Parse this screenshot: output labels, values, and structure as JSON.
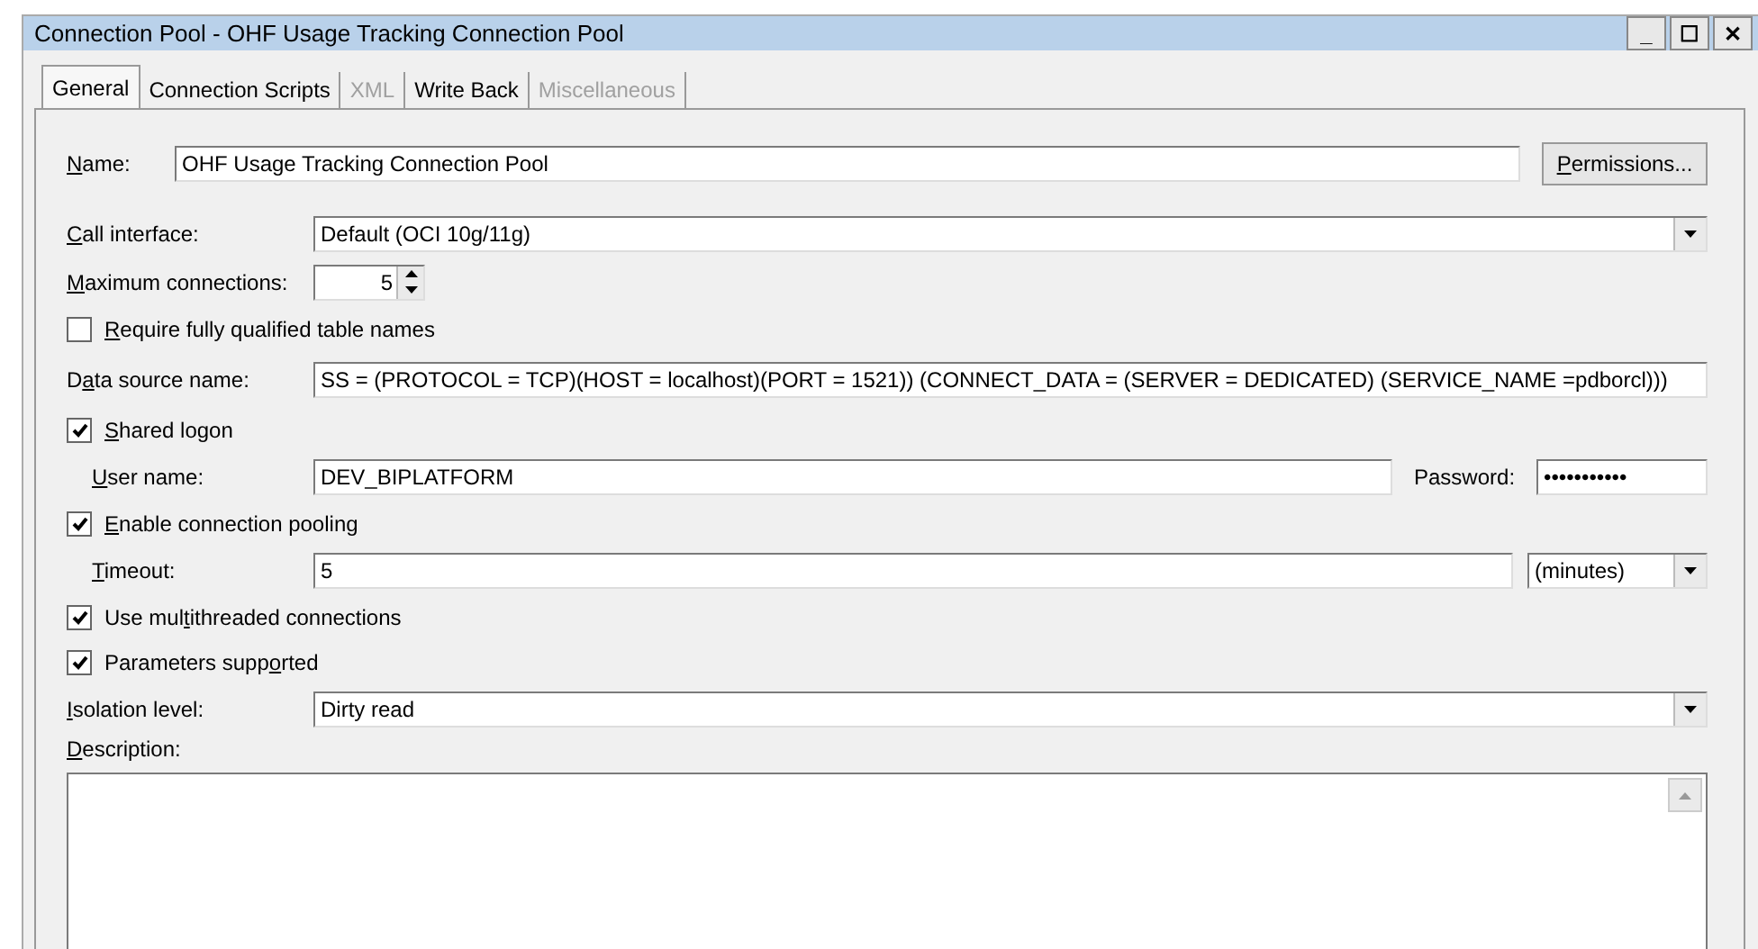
{
  "window": {
    "title": "Connection Pool - OHF Usage Tracking Connection Pool",
    "controls": [
      "_",
      "☐",
      "✕"
    ]
  },
  "tabs": [
    {
      "label": "General",
      "selected": true,
      "disabled": false
    },
    {
      "label": "Connection Scripts",
      "selected": false,
      "disabled": false
    },
    {
      "label": "XML",
      "selected": false,
      "disabled": true
    },
    {
      "label": "Write Back",
      "selected": false,
      "disabled": false
    },
    {
      "label": "Miscellaneous",
      "selected": false,
      "disabled": true
    }
  ],
  "form": {
    "name": {
      "label": {
        "key": "N",
        "post": "ame:"
      },
      "value": "OHF Usage Tracking Connection Pool",
      "button": {
        "key": "P",
        "post": "ermissions..."
      }
    },
    "call_interface": {
      "label": {
        "key": "C",
        "post": "all interface:"
      },
      "value": "Default (OCI 10g/11g)"
    },
    "max_connections": {
      "label": {
        "key": "M",
        "post": "aximum connections:"
      },
      "value": "5"
    },
    "require_qualified": {
      "label": {
        "key": "R",
        "post": "equire fully qualified table names"
      },
      "checked": false
    },
    "data_source": {
      "label": {
        "pre": "D",
        "key": "a",
        "post": "ta source name:"
      },
      "value": "SS = (PROTOCOL = TCP)(HOST = localhost)(PORT = 1521)) (CONNECT_DATA = (SERVER = DEDICATED) (SERVICE_NAME =pdborcl)))"
    },
    "shared_logon": {
      "label": {
        "key": "S",
        "post": "hared logon"
      },
      "checked": true
    },
    "user_name": {
      "label": {
        "key": "U",
        "post": "ser name:"
      },
      "value": "DEV_BIPLATFORM"
    },
    "password": {
      "label": {
        "pre": "Password:"
      },
      "value": "•••••••••••"
    },
    "enable_pooling": {
      "label": {
        "key": "E",
        "post": "nable connection pooling"
      },
      "checked": true
    },
    "timeout": {
      "label": {
        "key": "T",
        "post": "imeout:"
      },
      "value": "5",
      "unit": "(minutes)"
    },
    "multithreaded": {
      "label": {
        "pre": "Use mul",
        "key": "t",
        "post": "ithreaded connections"
      },
      "checked": true
    },
    "parameters": {
      "label": {
        "pre": "Parameters supp",
        "key": "o",
        "post": "rted"
      },
      "checked": true
    },
    "isolation": {
      "label": {
        "key": "I",
        "post": "solation level:"
      },
      "value": "Dirty read"
    },
    "description": {
      "label": {
        "key": "D",
        "post": "escription:"
      }
    }
  }
}
